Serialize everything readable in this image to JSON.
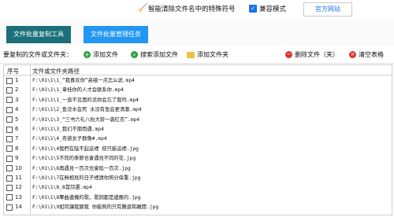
{
  "topbar": {
    "strip_label": "智能清除文件名中的特殊符号",
    "compat_label": "兼容模式",
    "official_label": "官方网站"
  },
  "tabs": [
    {
      "label": "文件批量复制工具"
    },
    {
      "label": "文件批量管理任务"
    }
  ],
  "toolbar": {
    "section_label": "要复制的文件或文件夹：",
    "add_file": "添加文件",
    "search_add_file": "搜索添加文件",
    "add_folder": "添加文件夹",
    "remove": "删除文件（夹）",
    "clear": "清空表格"
  },
  "table": {
    "columns": [
      "序号",
      "文件或文件夹路径"
    ],
    "rows": [
      {
        "num": "1",
        "path": "F:\\01\\1\\1_“我喜欢你”高级一点怎么说.mp4"
      },
      {
        "num": "2",
        "path": "F:\\01\\1\\1_拿桂你的人才会联系你.mp4"
      },
      {
        "num": "3",
        "path": "F:\\01\\1\\1_一直不见面的话你会忘了我吗.mp4"
      },
      {
        "num": "4",
        "path": "F:\\01\\1\\2_鱼没水会死 水没有鱼会更清澈.mp4"
      },
      {
        "num": "5",
        "path": "F:\\01\\1\\3_“三书六礼八抬大轿一袭红衣”.mp4"
      },
      {
        "num": "6",
        "path": "F:\\01\\1\\3_我们不期而遇.mp4"
      },
      {
        "num": "7",
        "path": "F:\\01\\1\\4_奇葩女子群像#.mp4"
      },
      {
        "num": "8",
        "path": "F:\\01\\1\\4我們在陰不起這裡 但只能這裡.jpg"
      },
      {
        "num": "9",
        "path": "F:\\01\\1\\5不同的季節也會遇見不同的花.jpg"
      },
      {
        "num": "10",
        "path": "F:\\01\\1\\6再遇見一百次也會陷一百次.jpg"
      },
      {
        "num": "11",
        "path": "F:\\01\\1\\7在無相見的日子裡請你照分保重.jpg"
      },
      {
        "num": "12",
        "path": "F:\\01\\1\\8_8首詩選.mp4"
      },
      {
        "num": "13",
        "path": "F:\\01\\1\\8畢曲邊機的歌，歌詞都是邊應的.jpg"
      },
      {
        "num": "14",
        "path": "F:\\01\\1\\9如同讓我變我 你能夠的只有難遊和離開.jpg"
      }
    ]
  }
}
